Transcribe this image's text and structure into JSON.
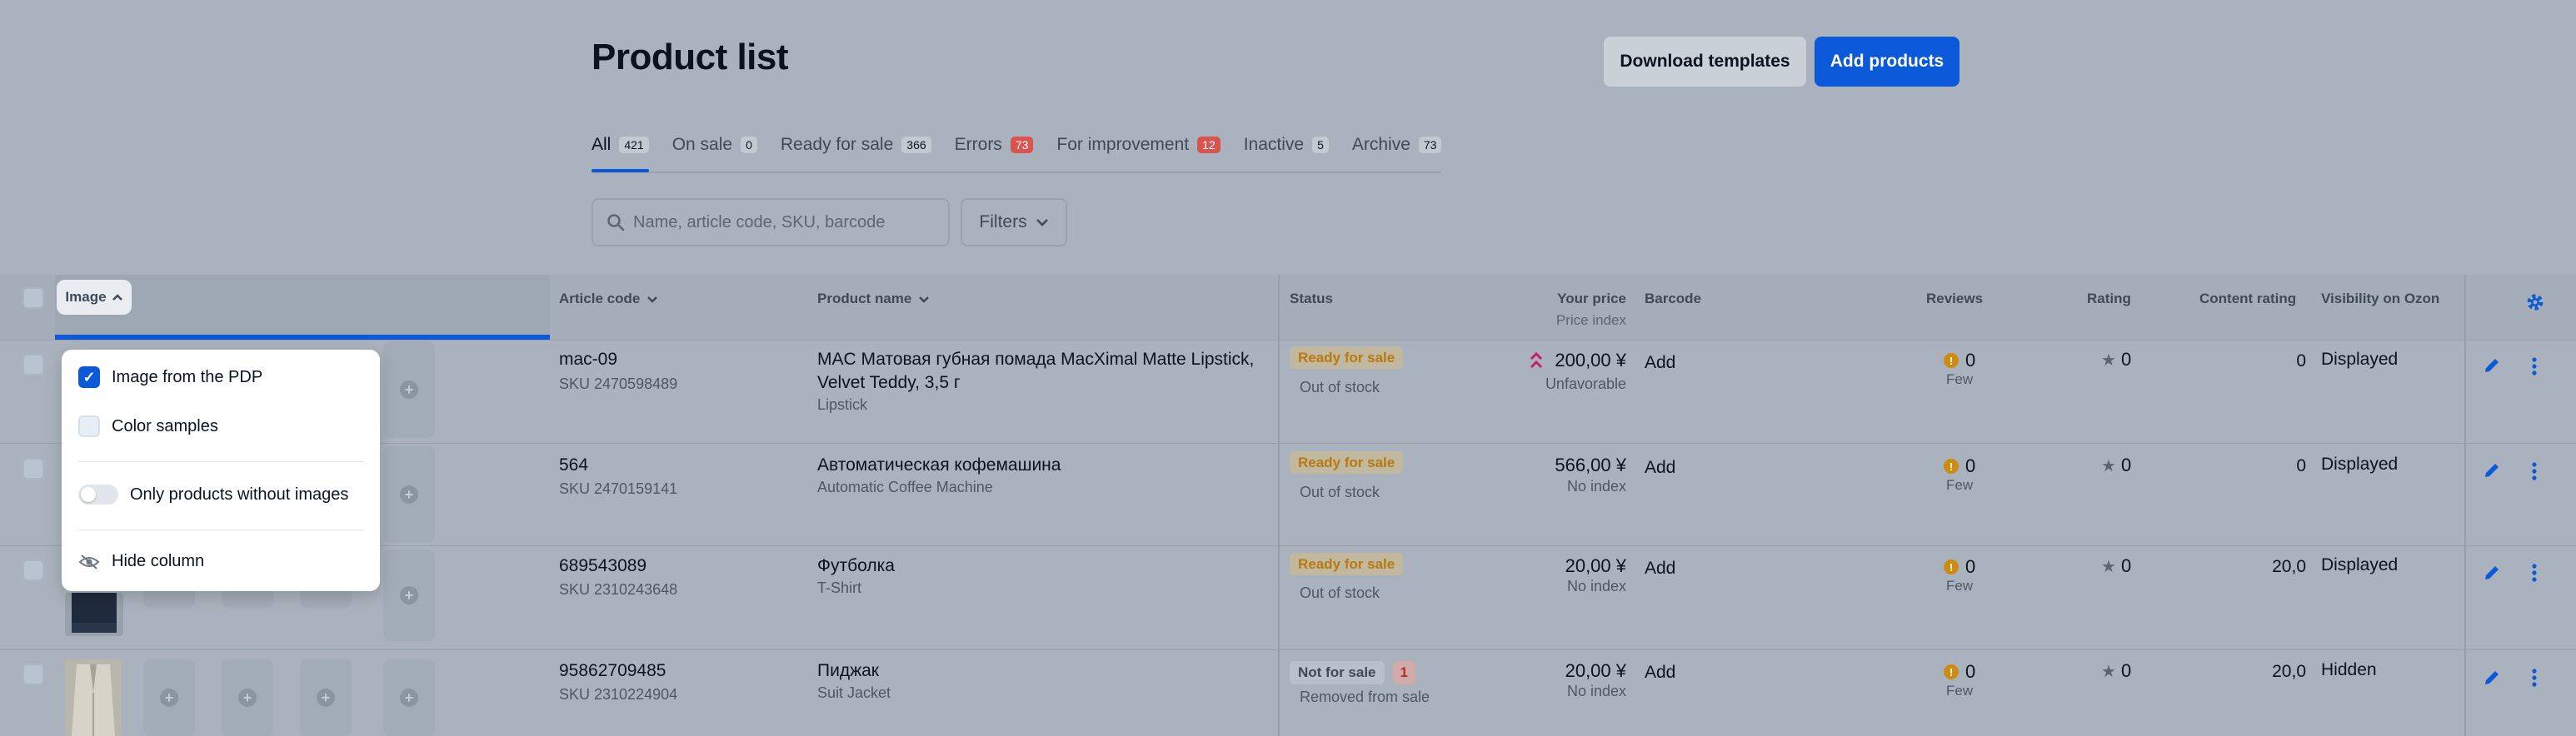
{
  "header": {
    "title": "Product list",
    "download_label": "Download templates",
    "add_label": "Add products"
  },
  "tabs": [
    {
      "label": "All",
      "count": "421",
      "active": true
    },
    {
      "label": "On sale",
      "count": "0"
    },
    {
      "label": "Ready for sale",
      "count": "366"
    },
    {
      "label": "Errors",
      "count": "73",
      "red": true
    },
    {
      "label": "For improvement",
      "count": "12",
      "red": true
    },
    {
      "label": "Inactive",
      "count": "5"
    },
    {
      "label": "Archive",
      "count": "73"
    }
  ],
  "search": {
    "placeholder": "Name, article code, SKU, barcode"
  },
  "filters_label": "Filters",
  "columns": {
    "image": "Image",
    "article": "Article code",
    "product": "Product name",
    "status": "Status",
    "price": "Your price",
    "price_sub": "Price index",
    "barcode": "Barcode",
    "reviews": "Reviews",
    "rating": "Rating",
    "content": "Content rating",
    "visibility": "Visibility on Ozon"
  },
  "rows": [
    {
      "code": "mac-09",
      "sku": "SKU 2470598489",
      "name": "MAC Матовая губная помада MacXimal Matte Lipstick, Velvet Teddy, 3,5 г",
      "sub": "Lipstick",
      "status": "Ready for sale",
      "status_sub": "Out of stock",
      "price": "200,00 ¥",
      "price_idx": "Unfavorable",
      "barcode": "Add",
      "reviews": "0",
      "reviews_sub": "Few",
      "rating": "0",
      "content": "0",
      "visibility": "Displayed"
    },
    {
      "code": "564",
      "sku": "SKU 2470159141",
      "name": "Автоматическая кофемашина",
      "sub": "Automatic Coffee Machine",
      "status": "Ready for sale",
      "status_sub": "Out of stock",
      "price": "566,00 ¥",
      "price_idx": "No index",
      "barcode": "Add",
      "reviews": "0",
      "reviews_sub": "Few",
      "rating": "0",
      "content": "0",
      "visibility": "Displayed"
    },
    {
      "code": "689543089",
      "sku": "SKU 2310243648",
      "name": "Футболка",
      "sub": "T-Shirt",
      "status": "Ready for sale",
      "status_sub": "Out of stock",
      "price": "20,00 ¥",
      "price_idx": "No index",
      "barcode": "Add",
      "reviews": "0",
      "reviews_sub": "Few",
      "rating": "0",
      "content": "20,0",
      "visibility": "Displayed"
    },
    {
      "code": "95862709485",
      "sku": "SKU 2310224904",
      "name": "Пиджак",
      "sub": "Suit Jacket",
      "status": "Not for sale",
      "status_count": "1",
      "status_sub": "Removed from sale",
      "price": "20,00 ¥",
      "price_idx": "No index",
      "barcode": "Add",
      "reviews": "0",
      "reviews_sub": "Few",
      "rating": "0",
      "content": "20,0",
      "visibility": "Hidden"
    }
  ],
  "popup": {
    "option1": "Image from the PDP",
    "option2": "Color samples",
    "toggle_label": "Only products without images",
    "hide_label": "Hide column"
  },
  "colors": {
    "accent": "#0b58d9",
    "warning": "#cf8a12",
    "error": "#d9534f"
  }
}
